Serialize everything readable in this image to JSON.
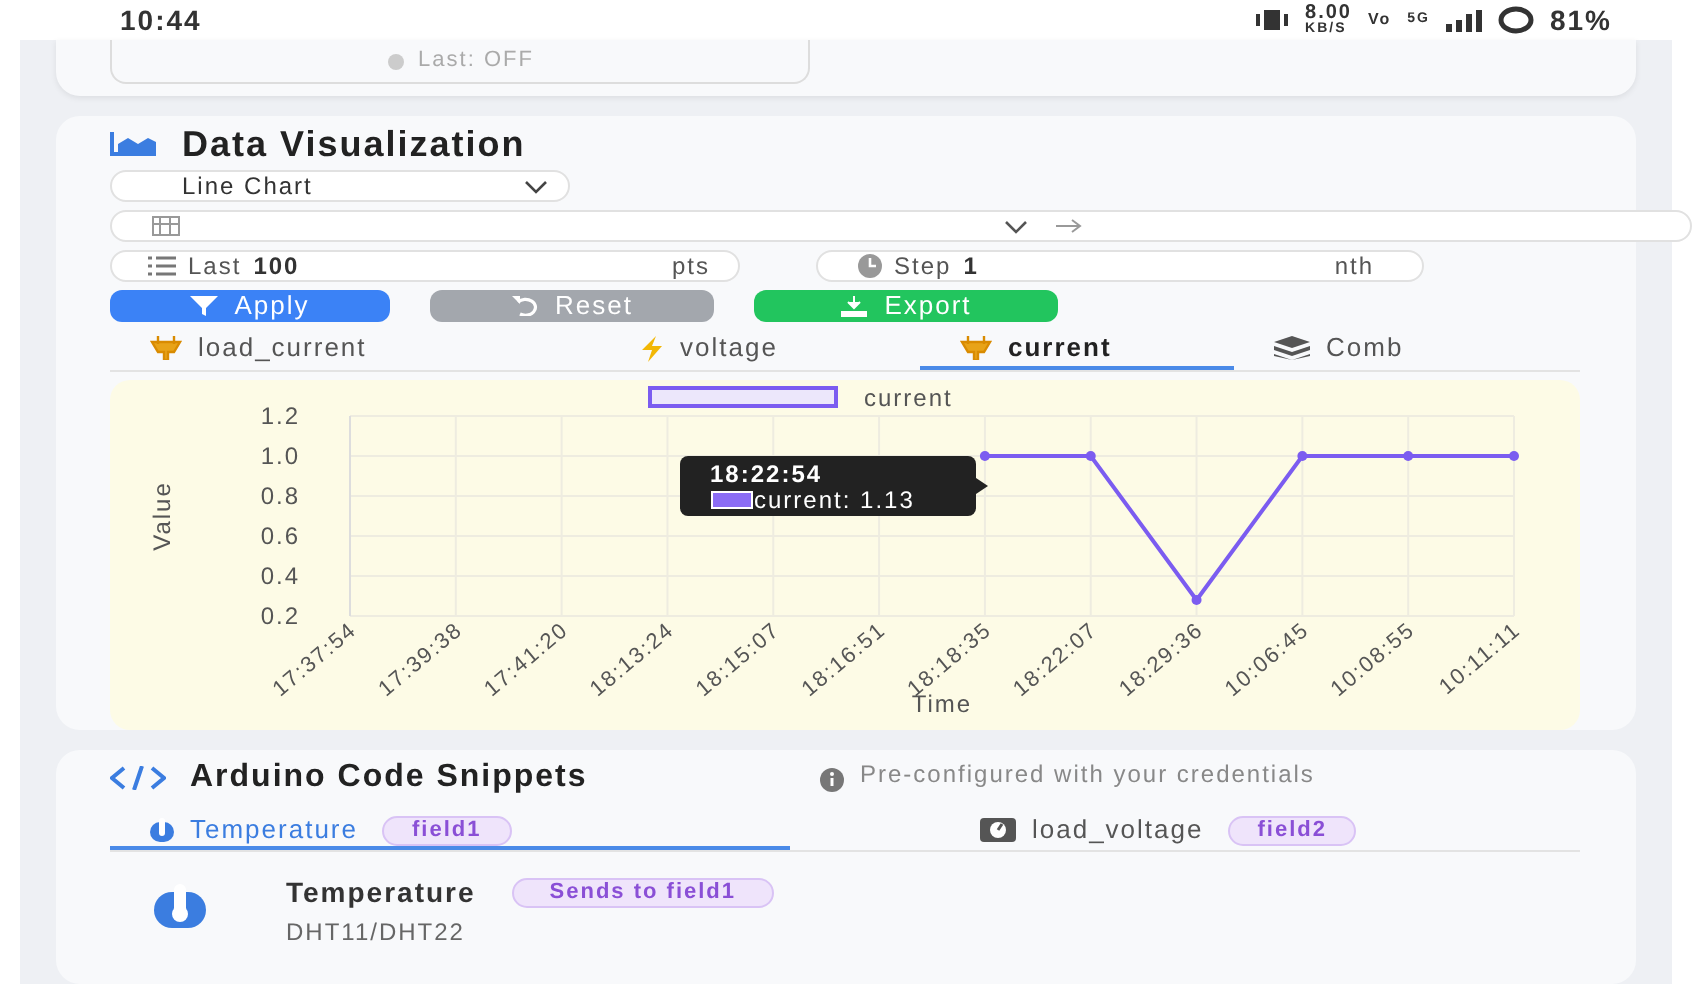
{
  "status_bar": {
    "time": "10:44",
    "speed": "8.00",
    "speed_unit": "KB/S",
    "volte": "Vo",
    "network": "5G",
    "battery": "81%"
  },
  "previous_card": {
    "status": "Last: OFF"
  },
  "data_visualization": {
    "title": "Data Visualization",
    "chart_type": "Line Chart",
    "last": {
      "label": "Last",
      "value": "100",
      "unit": "pts"
    },
    "step": {
      "label": "Step",
      "value": "1",
      "unit": "nth"
    },
    "buttons": [
      {
        "label": "Apply",
        "kind": "apply"
      },
      {
        "label": "Reset",
        "kind": "reset"
      },
      {
        "label": "Export",
        "kind": "export"
      }
    ],
    "tabs": [
      {
        "label": "load_current",
        "kind": "plug",
        "selected": false
      },
      {
        "label": "voltage",
        "kind": "bolt",
        "selected": false
      },
      {
        "label": "current",
        "kind": "plug",
        "selected": true
      },
      {
        "label": "Comb",
        "kind": "layers",
        "selected": false
      }
    ],
    "tooltip": {
      "title": "18:22:54",
      "text": "current: 1.13"
    },
    "chart_data": {
      "type": "line",
      "xlabel": "Time",
      "ylabel": "Value",
      "categories": [
        "17:37:54",
        "17:39:38",
        "17:41:20",
        "18:13:24",
        "18:15:07",
        "18:16:51",
        "18:18:35",
        "18:22:07",
        "18:29:36",
        "10:06:45",
        "10:08:55",
        "10:11:11"
      ],
      "series": [
        {
          "name": "current",
          "color": "#7b5cf0",
          "values": [
            null,
            null,
            null,
            null,
            null,
            null,
            1.0,
            1.0,
            0.28,
            1.0,
            1.0,
            1.0
          ]
        }
      ],
      "ylim": [
        0.2,
        1.2
      ],
      "yticks": [
        0.2,
        0.4,
        0.6,
        0.8,
        {
          "value": 1,
          "label": "1.0"
        },
        1.2
      ],
      "grid": true,
      "marker": true
    }
  },
  "code_snippets": {
    "title": "Arduino Code Snippets",
    "note": "Pre-configured with your credentials",
    "tabs": [
      {
        "label": "Temperature",
        "badge": "field1",
        "kind": "thermometer",
        "selected": true
      },
      {
        "label": "load_voltage",
        "badge": "field2",
        "kind": "gauge",
        "selected": false
      }
    ],
    "item": {
      "title": "Temperature",
      "badge": "Sends to field1",
      "subtitle": "DHT11/DHT22"
    }
  }
}
